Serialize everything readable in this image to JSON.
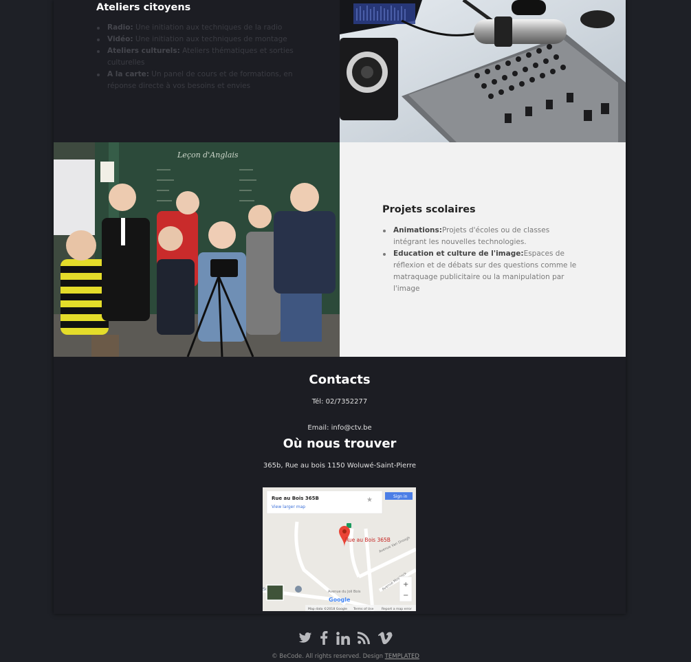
{
  "ateliers": {
    "title": "Ateliers citoyens",
    "items": [
      {
        "label": "Radio:",
        "text": " Une initiation aux techniques de la radio"
      },
      {
        "label": "Vidéo:",
        "text": " Une initiation aux techniques de montage"
      },
      {
        "label": "Ateliers culturels:",
        "text": " Ateliers thématiques et sorties culturelles"
      },
      {
        "label": "A la carte:",
        "text": " Un panel de cours et de formations, en réponse directe à vos besoins et envies"
      }
    ]
  },
  "projets": {
    "title": "Projets scolaires",
    "items": [
      {
        "label": "Animations:",
        "text": "Projets d'écoles ou de classes intégrant les nouvelles technologies."
      },
      {
        "label": "Education et culture de l'image:",
        "text": "Espaces de réflexion et de débats sur des questions comme le matraquage publicitaire ou la manipulation par l'image"
      }
    ]
  },
  "contacts": {
    "title": "Contacts",
    "tel": "Tél: 02/7352277",
    "email": "Email: info@ctv.be"
  },
  "location": {
    "title": "Où nous trouver",
    "address": "365b, Rue au bois 1150 Woluwé-Saint-Pierre"
  },
  "map": {
    "place_name": "Rue au Bois 365B",
    "larger_link": "View larger map",
    "sign_in": "Sign in",
    "marker_label": "Rue au Bois 365B",
    "street_1": "Avenue Van Droogh",
    "street_2": "Avenue du Joli Bois",
    "street_3": "Avenue Mostinck",
    "school": "School",
    "zoom_in": "+",
    "zoom_out": "−",
    "google": "Google",
    "attribution": "Map data ©2018 Google",
    "terms": "Terms of Use",
    "report": "Report a map error"
  },
  "photos": {
    "kids_board_text": "Leçon d'Anglais"
  },
  "social": {
    "icons": [
      "twitter-icon",
      "facebook-icon",
      "linkedin-icon",
      "rss-icon",
      "vimeo-icon"
    ]
  },
  "footer": {
    "text": "© BeCode. All rights reserved. Design ",
    "link": "TEMPLATED"
  }
}
